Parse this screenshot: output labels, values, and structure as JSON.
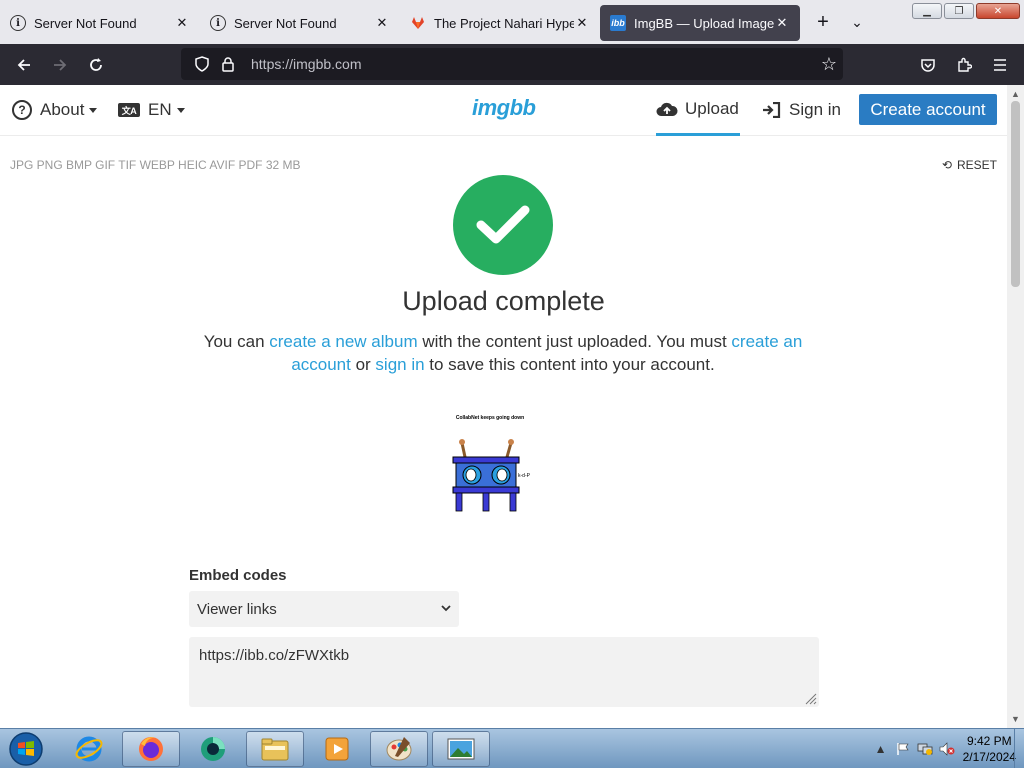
{
  "browser": {
    "tabs": [
      {
        "title": "Server Not Found",
        "favicon": "info-icon",
        "active": false
      },
      {
        "title": "Server Not Found",
        "favicon": "info-icon",
        "active": false
      },
      {
        "title": "The Project Nahari HyperV",
        "favicon": "gitlab-icon",
        "active": false
      },
      {
        "title": "ImgBB — Upload Image —",
        "favicon": "imgbb-icon",
        "active": true
      }
    ],
    "url": "https://imgbb.com",
    "favicon_imgbb_text": "ibb"
  },
  "site": {
    "logo": "imgbb",
    "nav": {
      "about": "About",
      "language": "EN",
      "language_icon": "文A",
      "upload": "Upload",
      "sign_in": "Sign in",
      "create_account": "Create account"
    },
    "formats": "JPG PNG BMP GIF TIF WEBP HEIC AVIF PDF  32 MB",
    "reset": "RESET",
    "upload_title": "Upload complete",
    "message": {
      "part1": "You can ",
      "link_album": "create a new album",
      "part2": " with the content just uploaded. You must ",
      "link_account": "create an account",
      "part3": " or ",
      "link_signin": "sign in",
      "part4": " to save this content into your account."
    },
    "thumbnail": {
      "caption": "CollabNet keeps going down",
      "side_label": "k-d-P"
    },
    "embed": {
      "label": "Embed codes",
      "selected": "Viewer links",
      "value": "https://ibb.co/zFWXtkb"
    }
  },
  "taskbar": {
    "time": "9:42 PM",
    "date": "2/17/2024"
  },
  "colors": {
    "accent": "#2a9fd8",
    "button": "#2a7cc3",
    "success": "#27ae60"
  }
}
